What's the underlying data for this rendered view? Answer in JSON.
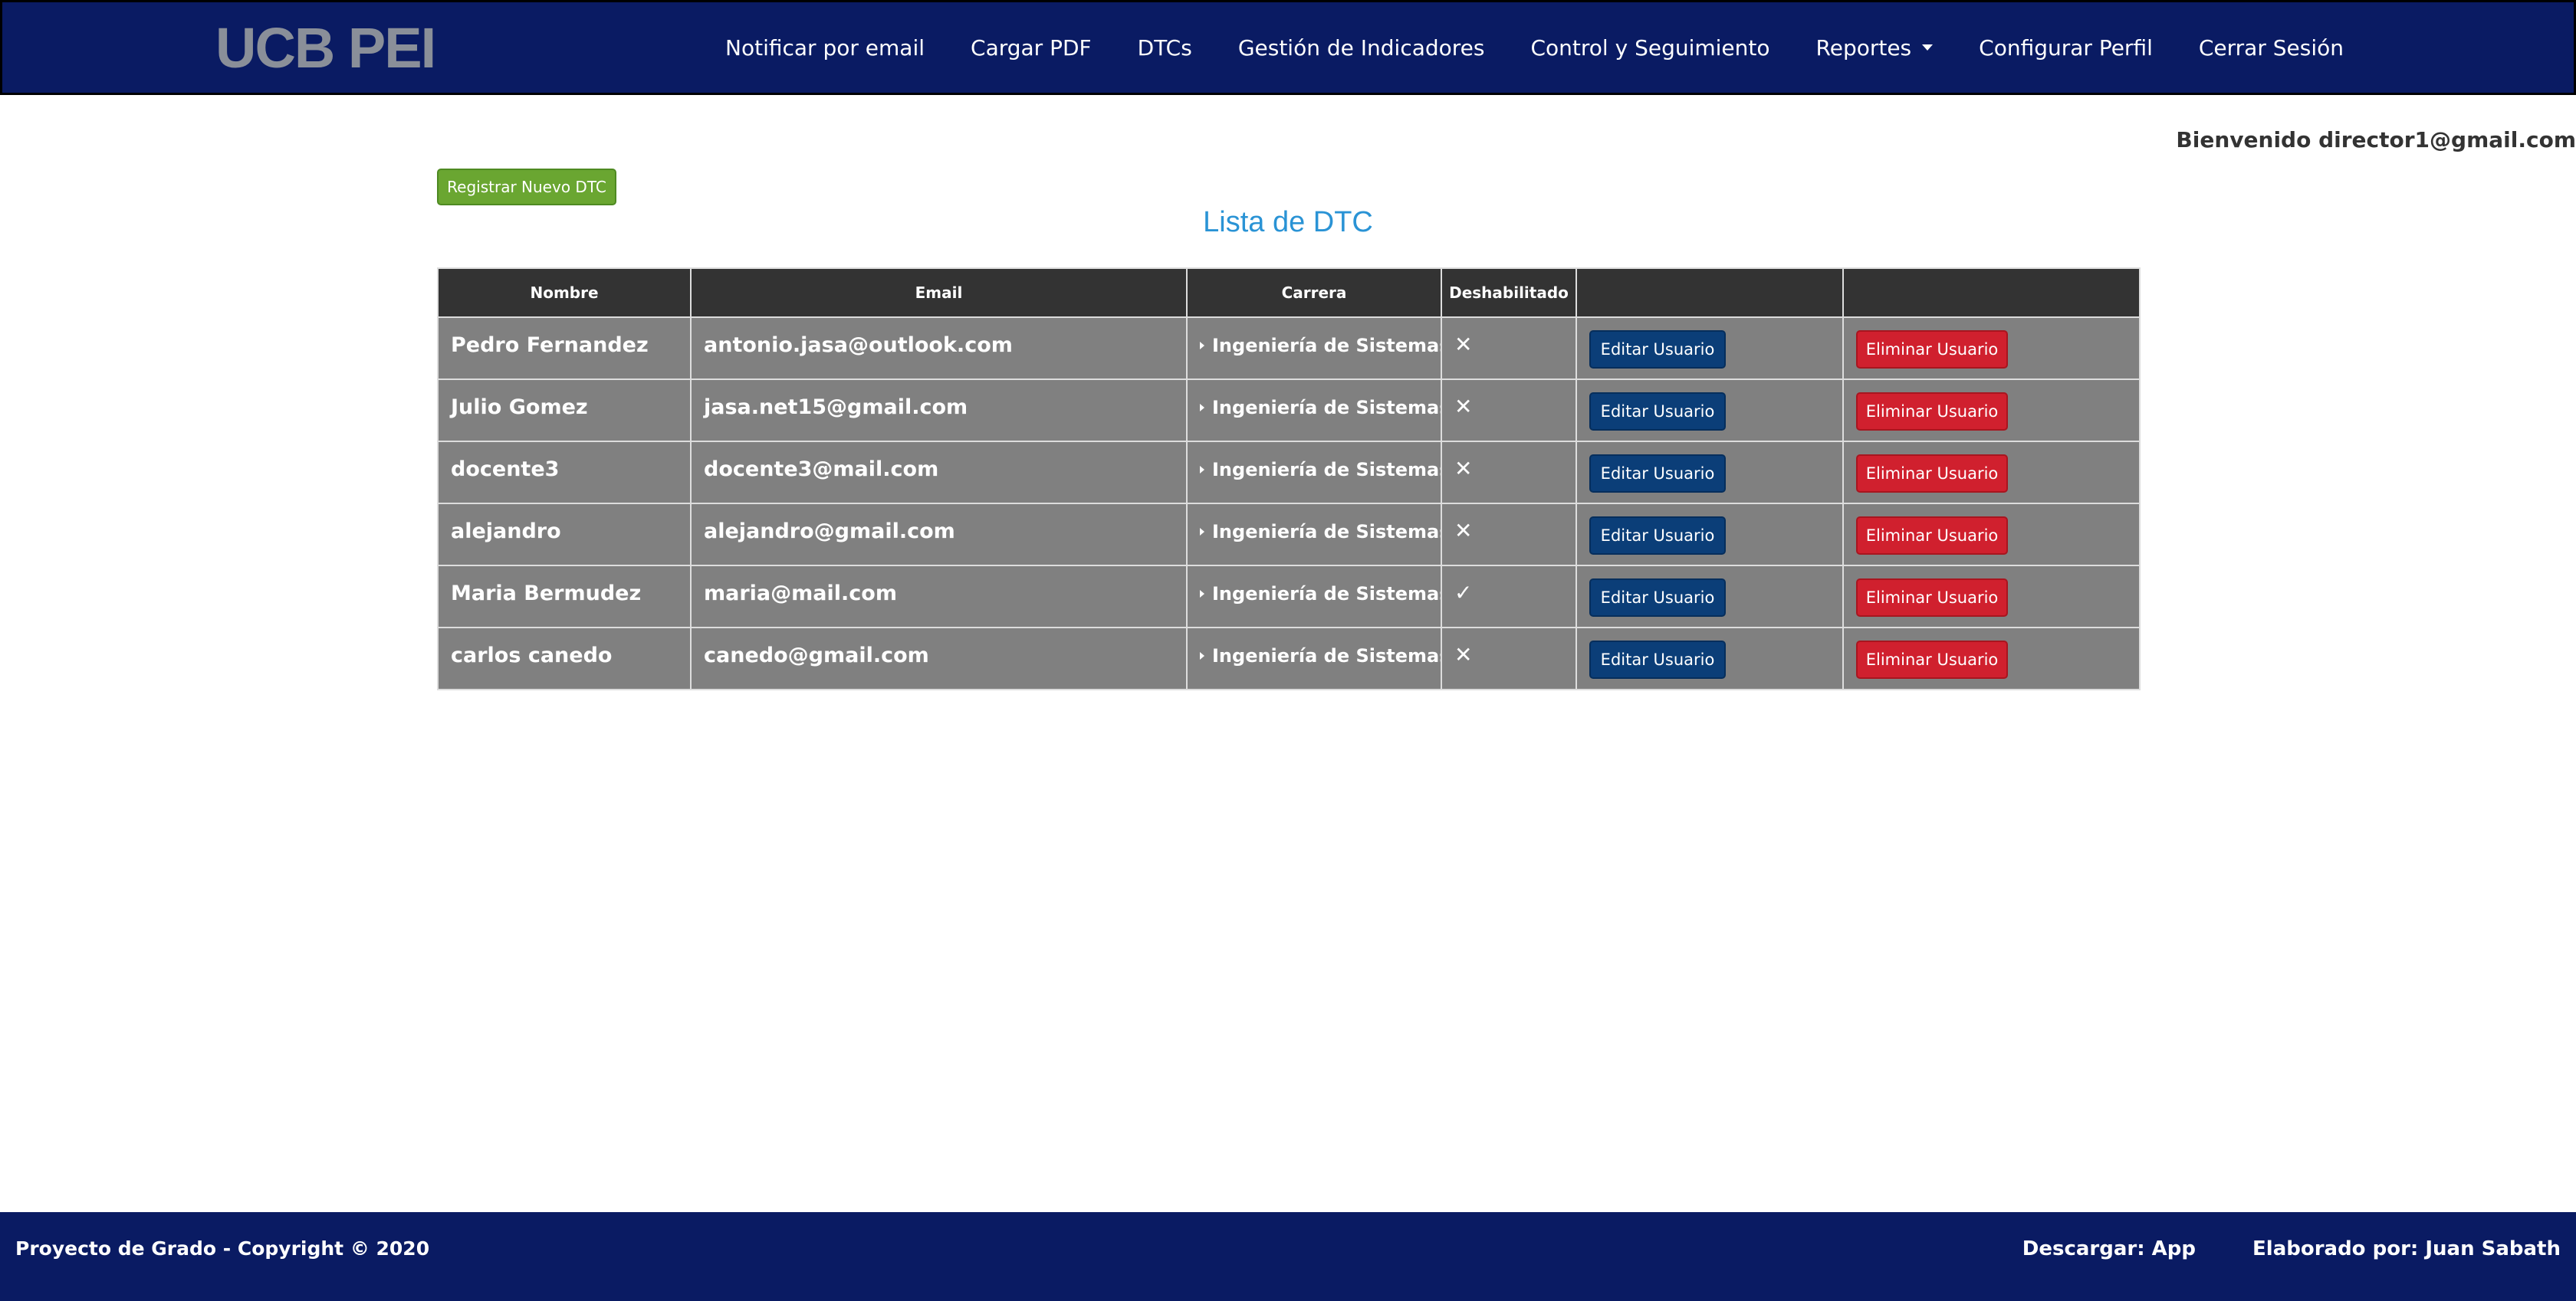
{
  "navbar": {
    "brand": "UCB PEI",
    "links": [
      {
        "label": "Notificar por email"
      },
      {
        "label": "Cargar PDF"
      },
      {
        "label": "DTCs"
      },
      {
        "label": "Gestión de Indicadores"
      },
      {
        "label": "Control y Seguimiento"
      },
      {
        "label": "Reportes",
        "dropdown": true
      },
      {
        "label": "Configurar Perfil"
      },
      {
        "label": "Cerrar Sesión"
      }
    ]
  },
  "welcome": "Bienvenido director1@gmail.com",
  "register_button": "Registrar Nuevo DTC",
  "page_title": "Lista de DTC",
  "table": {
    "headers": [
      "Nombre",
      "Email",
      "Carrera",
      "Deshabilitado",
      "",
      ""
    ],
    "edit_label": "Editar Usuario",
    "delete_label": "Eliminar Usuario",
    "rows": [
      {
        "nombre": "Pedro Fernandez",
        "email": "antonio.jasa@outlook.com",
        "carrera": "Ingeniería de Sistemas",
        "deshabilitado": false,
        "flag": "✕"
      },
      {
        "nombre": "Julio Gomez",
        "email": "jasa.net15@gmail.com",
        "carrera": "Ingeniería de Sistemas",
        "deshabilitado": false,
        "flag": "✕"
      },
      {
        "nombre": "docente3",
        "email": "docente3@mail.com",
        "carrera": "Ingeniería de Sistemas",
        "deshabilitado": false,
        "flag": "✕"
      },
      {
        "nombre": "alejandro",
        "email": "alejandro@gmail.com",
        "carrera": "Ingeniería de Sistemas",
        "deshabilitado": false,
        "flag": "✕"
      },
      {
        "nombre": "Maria Bermudez",
        "email": "maria@mail.com",
        "carrera": "Ingeniería de Sistemas",
        "deshabilitado": true,
        "flag": "✓"
      },
      {
        "nombre": "carlos canedo",
        "email": "canedo@gmail.com",
        "carrera": "Ingeniería de Sistemas",
        "deshabilitado": false,
        "flag": "✕"
      }
    ]
  },
  "footer": {
    "copyright": "Proyecto de Grado - Copyright © 2020",
    "download": "Descargar: App",
    "author": "Elaborado por: Juan Sabath"
  },
  "colors": {
    "navbar_bg": "#0a1b63",
    "brand": "#8a8f99",
    "title": "#2a93d5",
    "register_button": "#6aa631",
    "table_header": "#333333",
    "table_cell": "#808080",
    "edit_button": "#0b3e78",
    "delete_button": "#d0202e"
  }
}
